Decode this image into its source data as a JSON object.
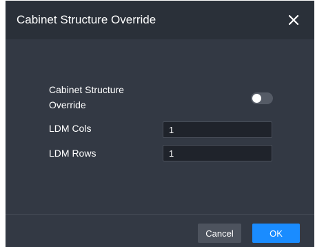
{
  "dialog": {
    "title": "Cabinet Structure Override",
    "close_icon": "close-icon"
  },
  "form": {
    "override_label": "Cabinet Structure Override",
    "override_enabled": false,
    "ldm_cols_label": "LDM Cols",
    "ldm_cols_value": "1",
    "ldm_rows_label": "LDM Rows",
    "ldm_rows_value": "1"
  },
  "footer": {
    "cancel_label": "Cancel",
    "ok_label": "OK"
  },
  "colors": {
    "dialog_bg": "#333944",
    "titlebar_bg": "#2a3039",
    "primary": "#1a8cff",
    "secondary_button": "#4d535e"
  }
}
